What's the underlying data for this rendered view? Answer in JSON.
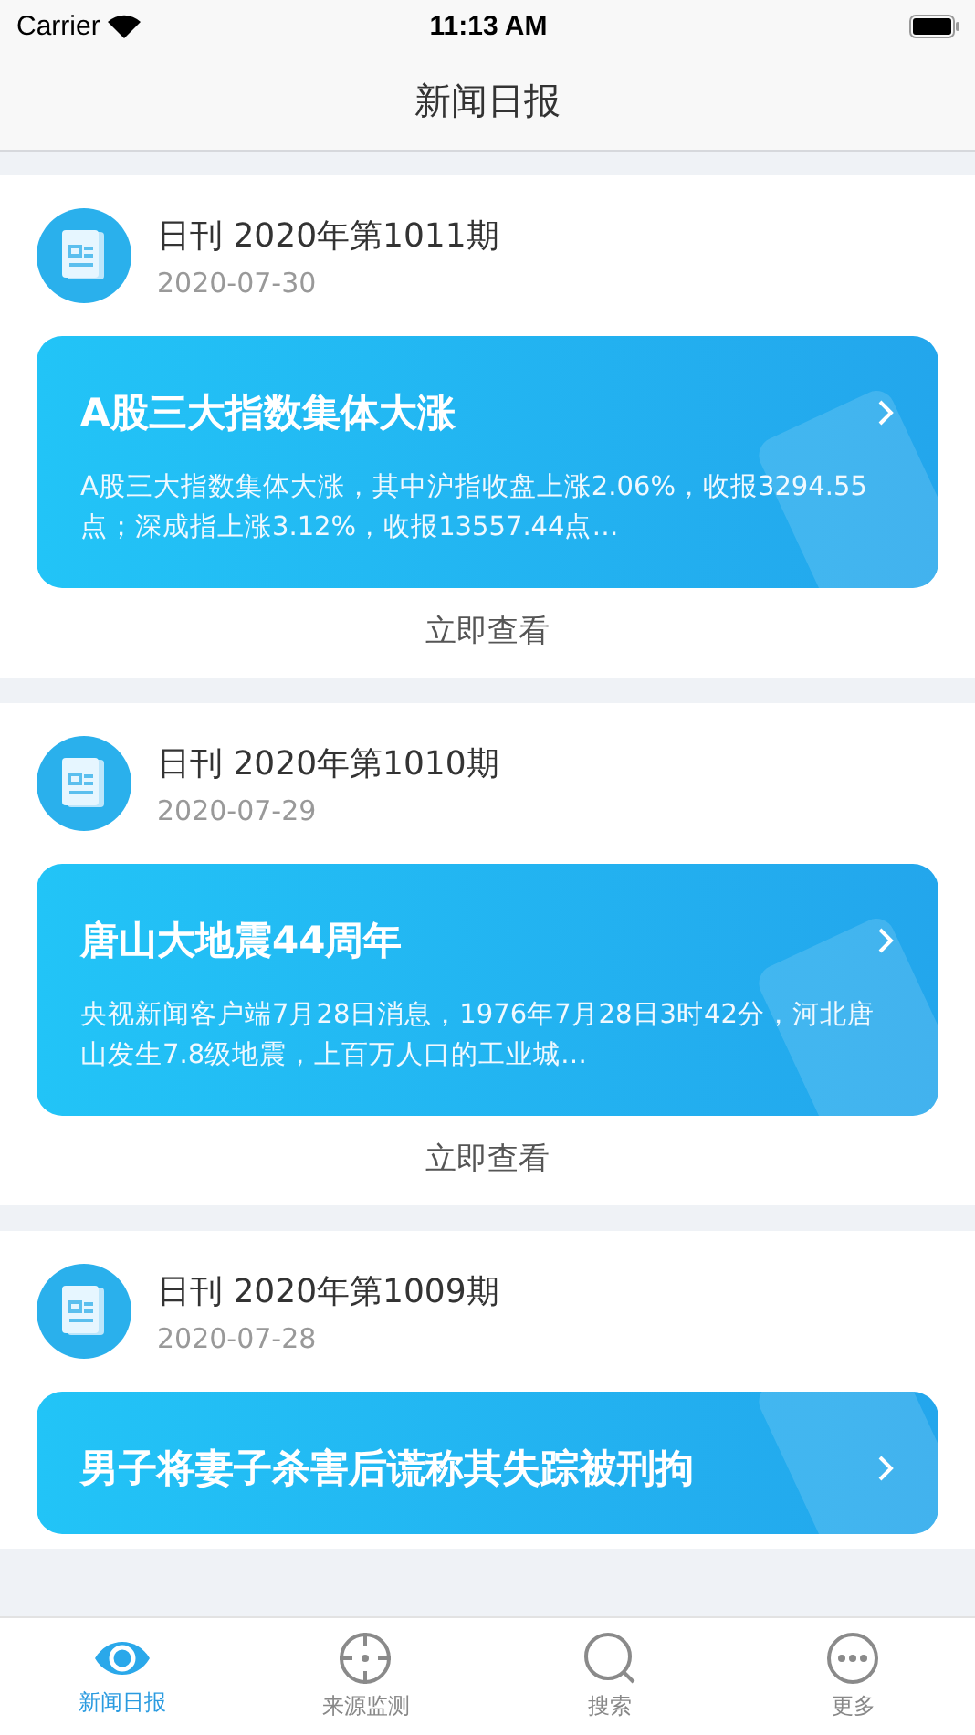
{
  "status_bar": {
    "carrier": "Carrier",
    "time": "11:13 AM"
  },
  "nav": {
    "title": "新闻日报"
  },
  "issues": [
    {
      "title": "日刊 2020年第1011期",
      "date": "2020-07-30",
      "headline": "A股三大指数集体大涨",
      "summary": "A股三大指数集体大涨，其中沪指收盘上涨2.06%，收报3294.55点；深成指上涨3.12%，收报13557.44点…",
      "action": "立即查看"
    },
    {
      "title": "日刊 2020年第1010期",
      "date": "2020-07-29",
      "headline": "唐山大地震44周年",
      "summary": "央视新闻客户端7月28日消息，1976年7月28日3时42分，河北唐山发生7.8级地震，上百万人口的工业城…",
      "action": "立即查看"
    },
    {
      "title": "日刊 2020年第1009期",
      "date": "2020-07-28",
      "headline": "男子将妻子杀害后谎称其失踪被刑拘"
    }
  ],
  "tabs": [
    {
      "kind": "eye",
      "label": "新闻日报",
      "selected": true
    },
    {
      "kind": "target",
      "label": "来源监测",
      "selected": false
    },
    {
      "kind": "search",
      "label": "搜索",
      "selected": false
    },
    {
      "kind": "more",
      "label": "更多",
      "selected": false
    }
  ]
}
